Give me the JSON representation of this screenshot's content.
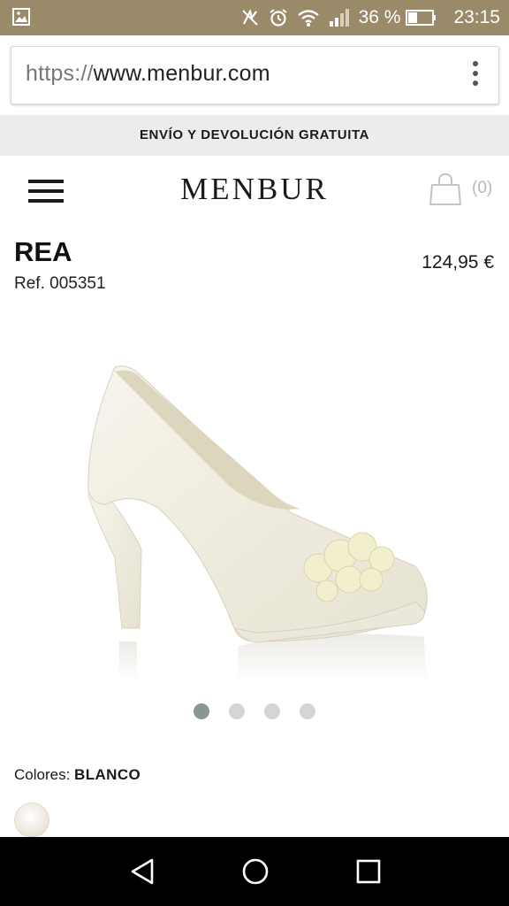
{
  "status_bar": {
    "battery_percent": "36 %",
    "time": "23:15"
  },
  "browser": {
    "url_scheme": "https://",
    "url_host": "www.menbur.com"
  },
  "promo_banner": "ENVÍO Y DEVOLUCIÓN GRATUITA",
  "header": {
    "logo": "MENBUR",
    "cart_count": "(0)"
  },
  "product": {
    "name": "REA",
    "ref": "Ref. 005351",
    "price": "124,95 €",
    "carousel": {
      "total": 4,
      "active_index": 0
    },
    "colors_label": "Colores:",
    "color_value": "BLANCO"
  },
  "icons": {
    "gallery": "gallery-icon",
    "nfc": "nfc-off-icon",
    "alarm": "alarm-icon",
    "wifi": "wifi-icon",
    "signal": "signal-icon",
    "battery": "battery-icon",
    "menu": "hamburger-icon",
    "cart": "shopping-bag-icon",
    "back": "back-icon",
    "home": "home-icon",
    "recents": "recents-icon"
  },
  "colors": {
    "status_bar_bg": "#9a8a6a",
    "promo_bg": "#ececec",
    "active_dot": "#8a9690",
    "inactive_dot": "#d4d4d4"
  }
}
